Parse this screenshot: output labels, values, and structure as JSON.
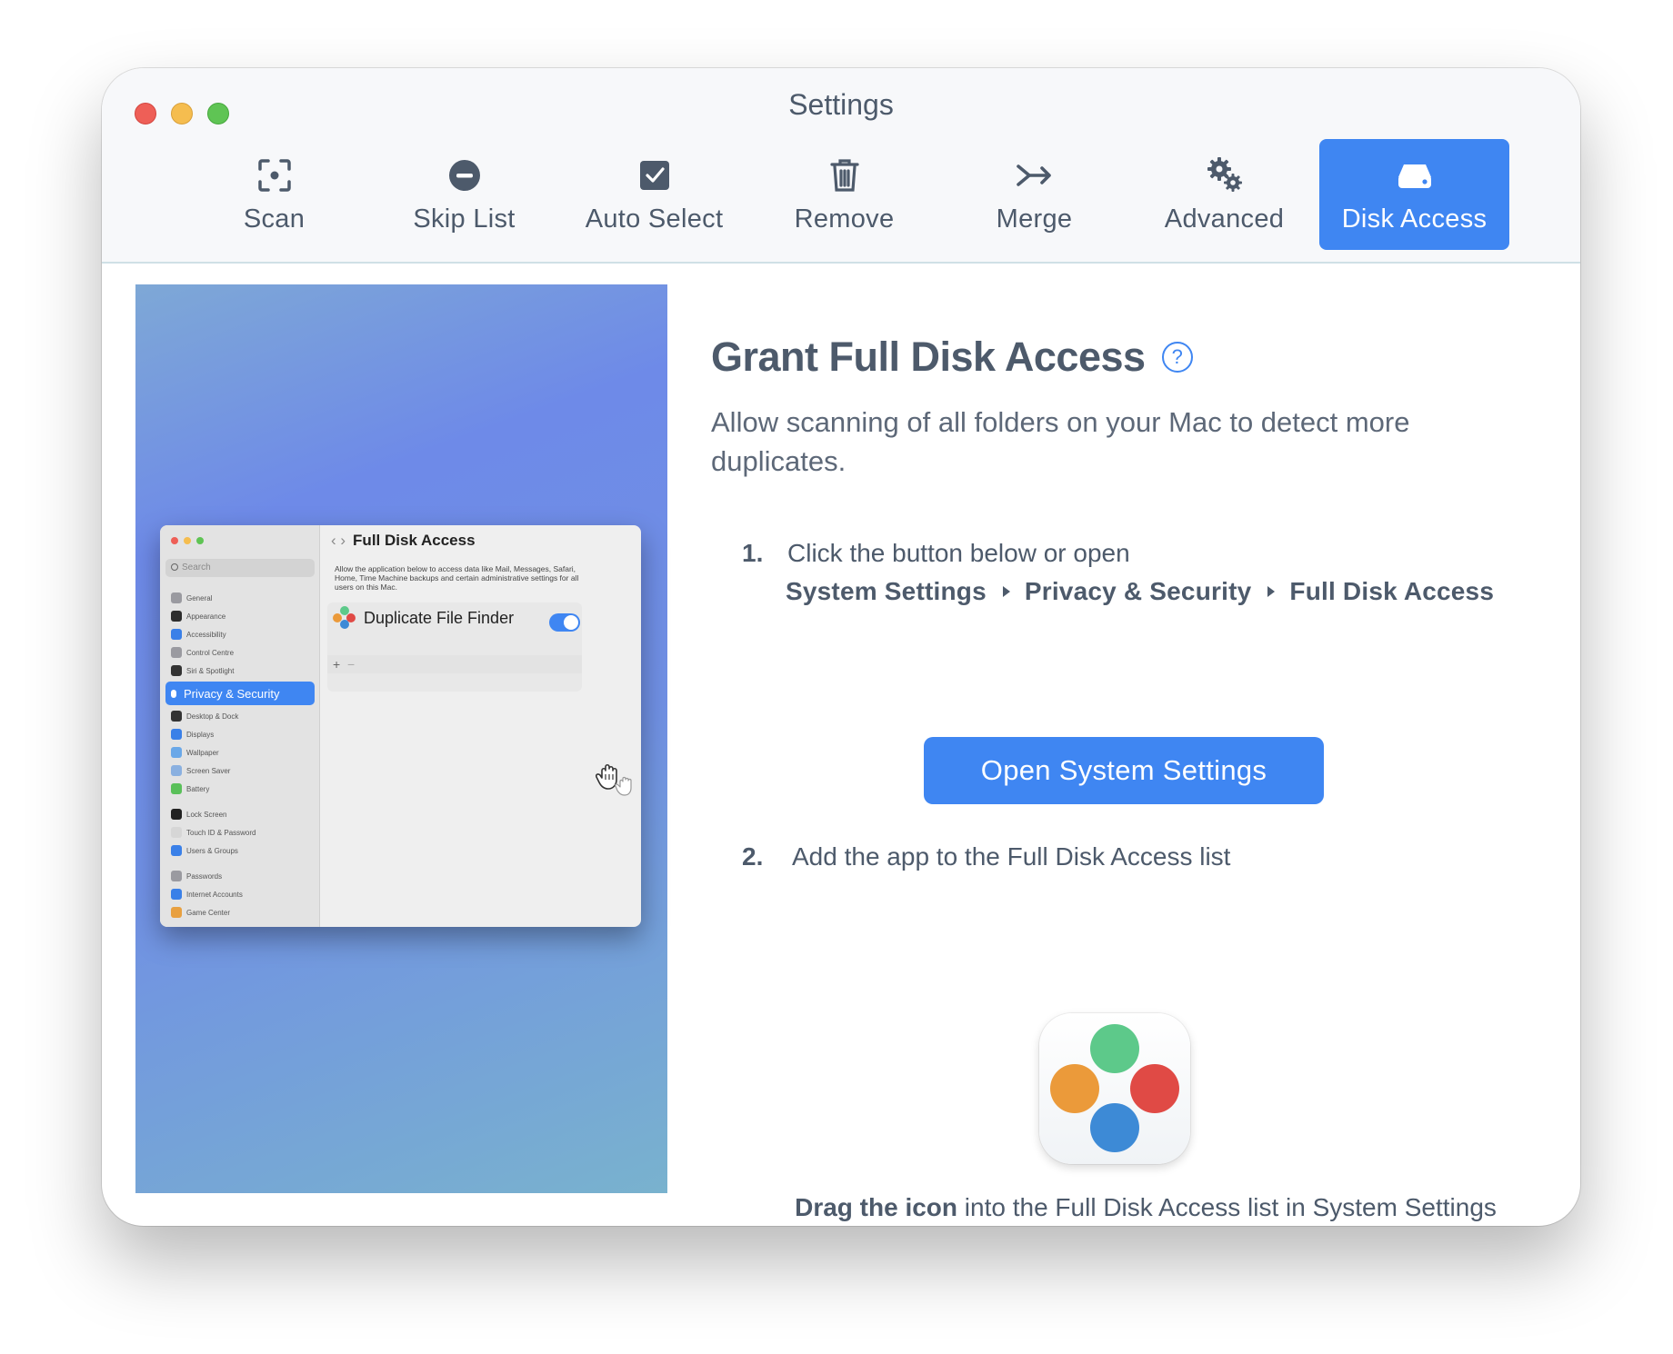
{
  "window": {
    "title": "Settings"
  },
  "toolbar": {
    "items": [
      {
        "label": "Scan",
        "icon": "scan-icon"
      },
      {
        "label": "Skip List",
        "icon": "minus-circle-icon"
      },
      {
        "label": "Auto Select",
        "icon": "checkbox-icon"
      },
      {
        "label": "Remove",
        "icon": "trash-icon"
      },
      {
        "label": "Merge",
        "icon": "merge-arrow-icon"
      },
      {
        "label": "Advanced",
        "icon": "gears-icon"
      },
      {
        "label": "Disk Access",
        "icon": "disk-icon",
        "active": true
      }
    ]
  },
  "preview": {
    "search_placeholder": "Search",
    "sidebar": [
      "General",
      "Appearance",
      "Accessibility",
      "Control Centre",
      "Siri & Spotlight",
      "Privacy & Security",
      "Desktop & Dock",
      "Displays",
      "Wallpaper",
      "Screen Saver",
      "Battery",
      "Lock Screen",
      "Touch ID & Password",
      "Users & Groups",
      "Passwords",
      "Internet Accounts",
      "Game Center"
    ],
    "title": "Full Disk Access",
    "description": "Allow the application below to access data like Mail, Messages, Safari, Home, Time Machine backups and certain administrative settings for all users on this Mac.",
    "app_name": "Duplicate File Finder",
    "toggle_on": true,
    "plus": "+",
    "minus": "−"
  },
  "main": {
    "title": "Grant Full Disk Access",
    "help": "?",
    "subtitle": "Allow scanning of all folders on your Mac to detect more duplicates.",
    "step1": {
      "number": "1.",
      "text": "Click the button below or open"
    },
    "path": [
      "System Settings",
      "Privacy & Security",
      "Full Disk Access"
    ],
    "button": "Open System Settings",
    "step2": {
      "number": "2.",
      "text": "Add the app to the Full Disk Access list"
    },
    "drag_bold": "Drag the icon",
    "drag_rest": " into the Full Disk Access list in System Settings"
  },
  "colors": {
    "accent": "#3f86f2",
    "text": "#4d5a6b",
    "icon_green": "#5dc98a",
    "icon_orange": "#eb9a3a",
    "icon_red": "#e04a45",
    "icon_blue": "#3d8ad6"
  }
}
